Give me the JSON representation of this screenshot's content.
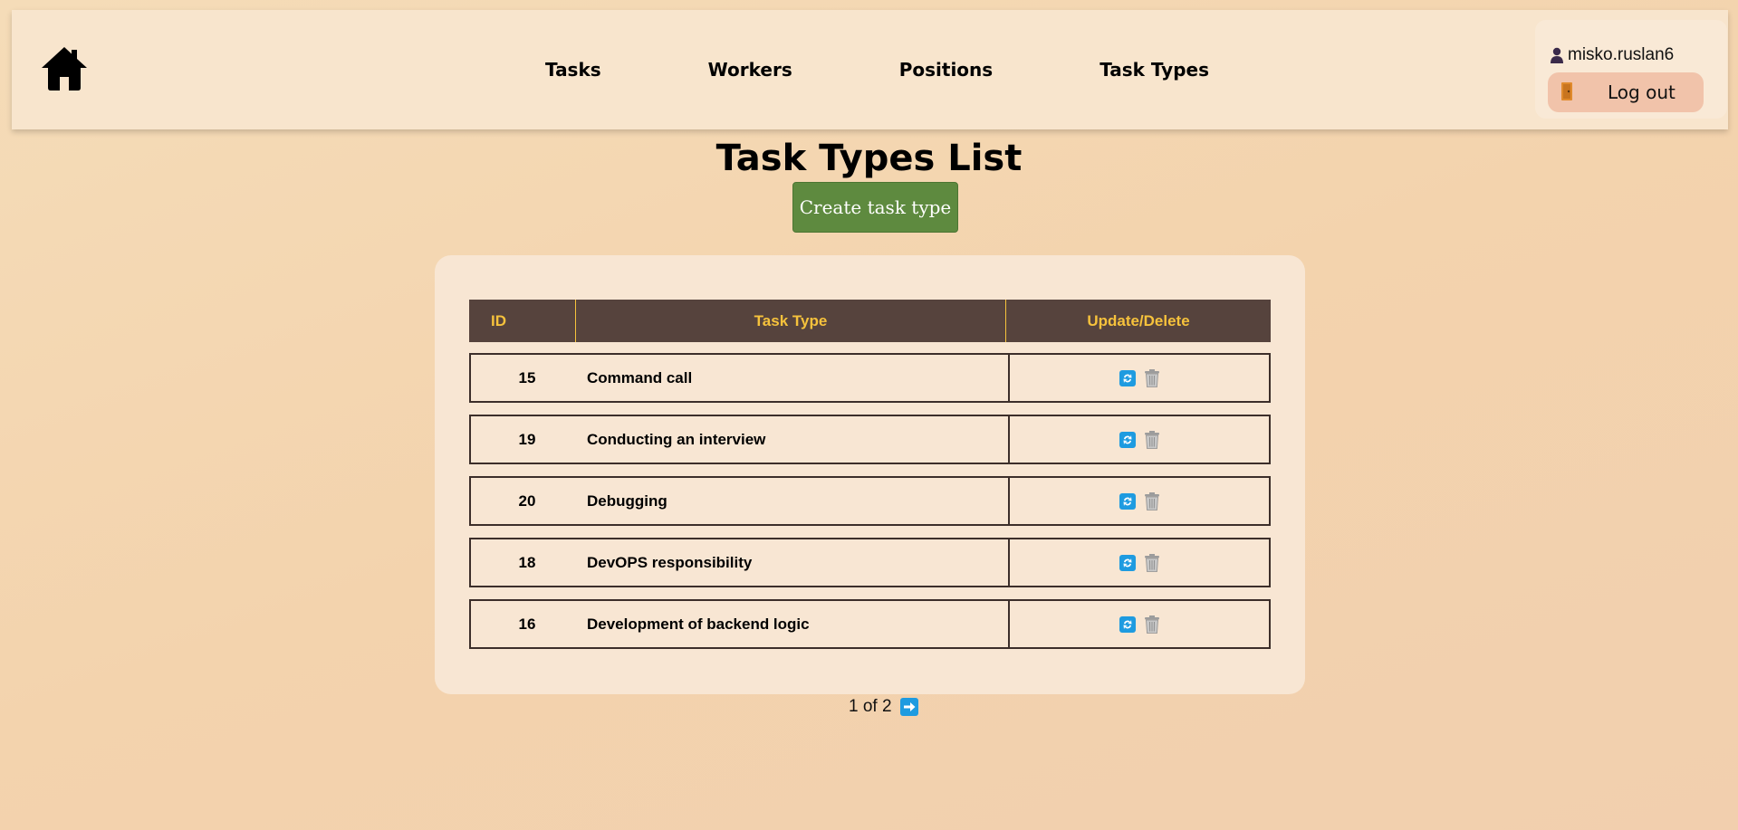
{
  "nav": {
    "home_icon": "home-icon",
    "links": [
      "Tasks",
      "Workers",
      "Positions",
      "Task Types"
    ]
  },
  "user": {
    "username": "misko.ruslan6",
    "user_icon": "user-icon",
    "logout_label": "Log out",
    "logout_icon": "door-icon"
  },
  "page": {
    "title": "Task Types List",
    "create_button": "Create task type"
  },
  "table": {
    "headers": {
      "id": "ID",
      "type": "Task Type",
      "actions": "Update/Delete"
    },
    "rows": [
      {
        "id": "15",
        "type": "Command call"
      },
      {
        "id": "19",
        "type": "Conducting an interview"
      },
      {
        "id": "20",
        "type": "Debugging"
      },
      {
        "id": "18",
        "type": "DevOPS responsibility"
      },
      {
        "id": "16",
        "type": "Development of backend logic"
      }
    ]
  },
  "pagination": {
    "text": "1 of 2",
    "next_icon": "arrow-right-icon"
  },
  "colors": {
    "header_bg": "#56433d",
    "header_text": "#f6c23c",
    "create_button": "#5e8a3f",
    "logout_button": "#f1c3aa",
    "update_icon": "#1e9be0"
  }
}
